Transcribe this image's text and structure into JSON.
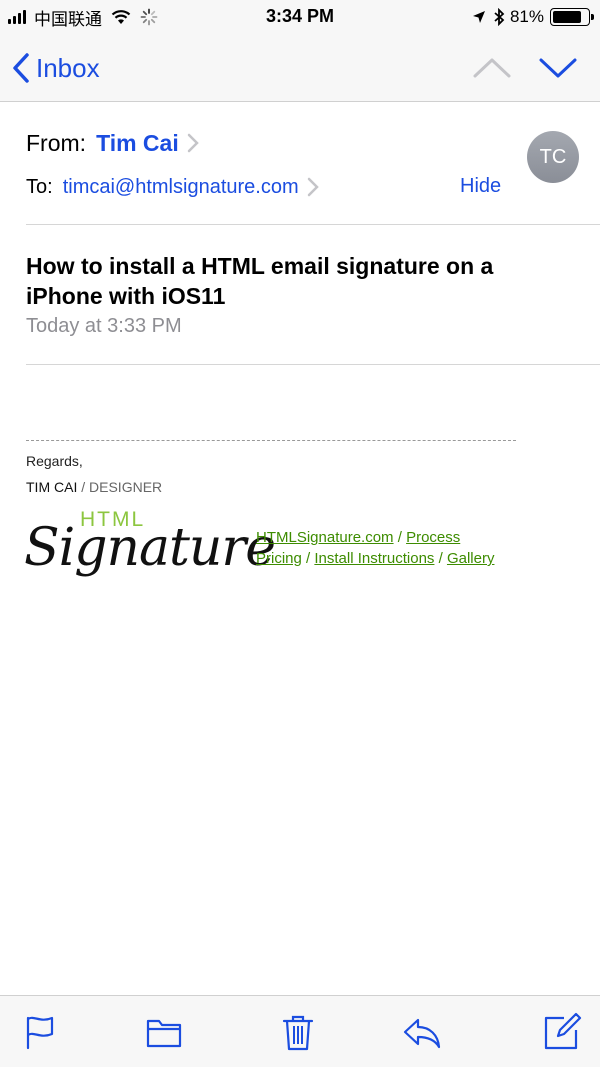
{
  "status_bar": {
    "carrier": "中国联通",
    "time": "3:34 PM",
    "battery": "81%",
    "battery_level": 0.81
  },
  "nav": {
    "back_label": "Inbox"
  },
  "message": {
    "from_label": "From:",
    "from_name": "Tim Cai",
    "to_label": "To:",
    "to_address": "timcai@htmlsignature.com",
    "hide_label": "Hide",
    "avatar_initials": "TC",
    "subject": "How to install a HTML email signature on a iPhone with iOS11",
    "date": "Today at 3:33 PM"
  },
  "signature": {
    "regards": "Regards,",
    "name": "TIM CAI",
    "role": " / DESIGNER",
    "logo_top": "HTML",
    "logo_main": "Signature",
    "link_site": "HTMLSignature.com",
    "link_process": "Process",
    "link_pricing": "Pricing",
    "link_install": "Install Instructions",
    "link_gallery": "Gallery",
    "separator": " / "
  },
  "colors": {
    "accent": "#1b4de0",
    "logo_green": "#8cc63f",
    "link_green": "#3d8c00"
  },
  "toolbar": {
    "icons": [
      "flag-icon",
      "folder-icon",
      "trash-icon",
      "reply-icon",
      "compose-icon"
    ]
  }
}
